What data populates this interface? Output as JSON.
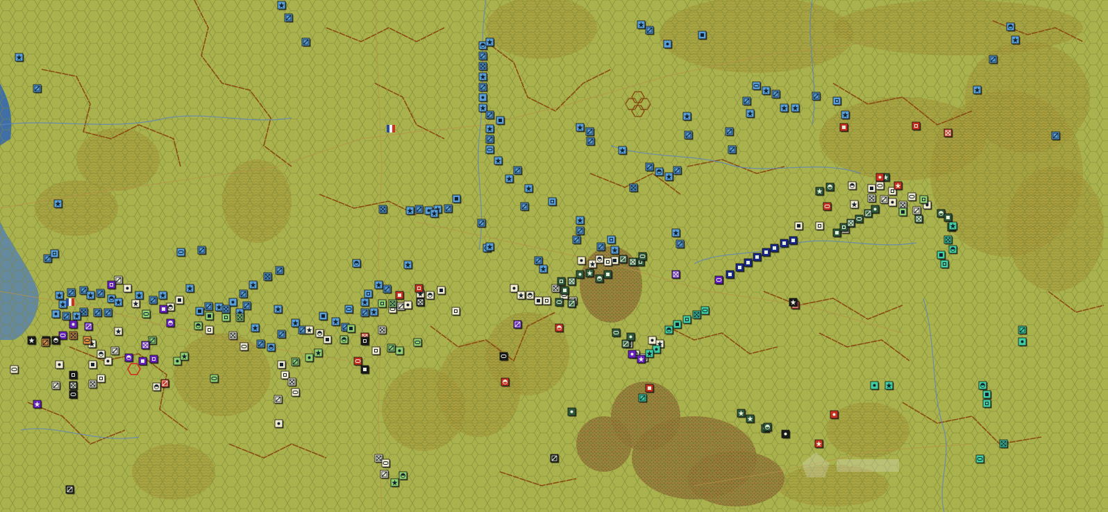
{
  "map": {
    "terrain_base_color": "#a9b24d",
    "hex_grid_color": "#7d8838",
    "hill_color": "#9a8a2c",
    "forest_color": "#8d7a32",
    "ridge_color": "#8a4b12",
    "road_color": "#b8924a",
    "river_color": "#5f86b8",
    "water_color": "#3f6fa6",
    "city_color": "#9a4a2a"
  },
  "factions": {
    "german": {
      "color": "#5aa0d8",
      "counter_style": "blue-square"
    },
    "allied_east": {
      "color": "#f2ecd0",
      "counter_style": "mixed"
    },
    "allied_west": {
      "color": "#2e5a3a",
      "counter_style": "mixed"
    },
    "french": {
      "color": "#e8e0c0",
      "flag": "tricolor-flag-icon"
    }
  },
  "unit_symbols": [
    "infantry-icon",
    "armor-icon",
    "cavalry-icon",
    "artillery-icon",
    "mech-icon",
    "hq-icon",
    "recon-icon",
    "depot-icon"
  ],
  "selection": {
    "color": "#d03020",
    "shape": "hex-outline"
  }
}
